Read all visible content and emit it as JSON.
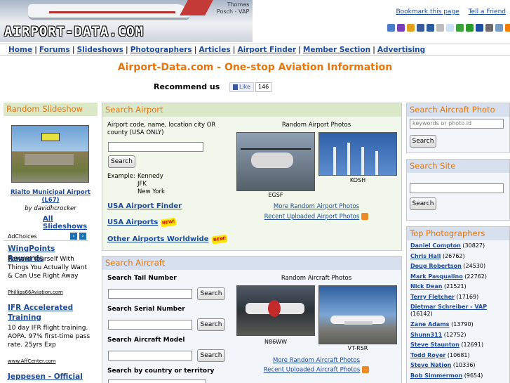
{
  "header": {
    "logo_text": "AIRPORT-DATA.COM",
    "photo_credit_line1": "Thomas",
    "photo_credit_line2": "Posch - VAP",
    "bookmark_label": "Bookmark this page",
    "tell_friend_label": "Tell a Friend",
    "social_icons": [
      {
        "name": "google-icon",
        "color": "#4a7ec8"
      },
      {
        "name": "yahoo-icon",
        "color": "#7b3fb5"
      },
      {
        "name": "windows-icon",
        "color": "#e1a21b"
      },
      {
        "name": "facebook-icon",
        "color": "#3b5998"
      },
      {
        "name": "digg-icon",
        "color": "#2a5d9f"
      },
      {
        "name": "delicious-icon",
        "color": "#bdbdbd"
      },
      {
        "name": "reddit-icon",
        "color": "#cde2f5"
      },
      {
        "name": "stumbleupon-icon",
        "color": "#3ca23c"
      },
      {
        "name": "technorati-icon",
        "color": "#2a9a2a"
      },
      {
        "name": "delicious-squares-icon",
        "color": "#1f4fa3"
      },
      {
        "name": "myspace-icon",
        "color": "#6b6b6b"
      },
      {
        "name": "share-icon",
        "color": "#7a9cc0"
      },
      {
        "name": "blogger-icon",
        "color": "#f57d00"
      }
    ]
  },
  "nav": {
    "items": [
      "Home",
      "Forums",
      "Slideshows",
      "Photographers",
      "Articles",
      "Airport Finder",
      "Member Section",
      "Advertising"
    ]
  },
  "headline": "Airport-Data.com - One-stop Aviation Information",
  "recommend": {
    "label": "Recommend us",
    "like_label": "Like",
    "like_count": "146"
  },
  "slideshow": {
    "title": "Random Slideshow",
    "caption_line1": "Rialto Municipal Airport",
    "caption_line2": "(L67)",
    "by": "by davidhcrocker",
    "all_link": "All Slideshows"
  },
  "ads": {
    "label": "AdChoices",
    "items": [
      {
        "title": "WingPoints Rewards",
        "body": "Reward Yourself With Things You Actually Want & Can Use Right Away",
        "url": "Phillips66Aviation.com"
      },
      {
        "title": "IFR Accelerated Training",
        "body": "10 day IFR flight training. AOPA. 97% first-time pass rate. 25yrs Exp",
        "url": "www.AffCenter.com"
      },
      {
        "title": "Jeppesen - Official Store",
        "body": "",
        "url": ""
      }
    ]
  },
  "search_airport": {
    "title": "Search Airport",
    "description": "Airport code, name, location city OR county (USA ONLY)",
    "input_value": "",
    "button": "Search",
    "example_label": "Example:",
    "examples": [
      "Kennedy",
      "JFK",
      "New York"
    ],
    "links": [
      "USA Airport Finder",
      "USA Airports",
      "Other Airports Worldwide"
    ],
    "new_badge": "NEW!",
    "random_title": "Random Airport Photos",
    "photos": [
      {
        "caption": "EGSF"
      },
      {
        "caption": "KOSH"
      }
    ],
    "more_link": "More Random Airport Photos",
    "recent_link": "Recent Uploaded Airport Photos"
  },
  "search_aircraft": {
    "title": "Search Aircraft",
    "tail_label": "Search Tail Number",
    "serial_label": "Search Serial Number",
    "model_label": "Search Aircraft Model",
    "country_label": "Search by country or territory",
    "button": "Search",
    "random_title": "Random Aircraft Photos",
    "photos": [
      {
        "caption": "N86WW"
      },
      {
        "caption": "VT-RSR"
      }
    ],
    "more_link": "More Random Aircraft Photos",
    "recent_link": "Recent Uploaded Aircraft Photos"
  },
  "search_photo": {
    "title": "Search Aircraft Photo",
    "placeholder": "keywords or photo id",
    "button": "Search"
  },
  "search_site": {
    "title": "Search Site",
    "button": "Search"
  },
  "top_photographers": {
    "title": "Top Photographers",
    "items": [
      {
        "name": "Daniel Compton",
        "count": "(30827)"
      },
      {
        "name": "Chris Hall",
        "count": "(26762)"
      },
      {
        "name": "Doug Robertson",
        "count": "(24530)"
      },
      {
        "name": "Mark Pasqualino",
        "count": "(22762)"
      },
      {
        "name": "Nick Dean",
        "count": "(21521)"
      },
      {
        "name": "Terry Fletcher",
        "count": "(17169)"
      },
      {
        "name": "Dietmar Schreiber - VAP",
        "count": "(16142)"
      },
      {
        "name": "Zane Adams",
        "count": "(13790)"
      },
      {
        "name": "Shunn311",
        "count": "(12752)"
      },
      {
        "name": "Steve Staunton",
        "count": "(12691)"
      },
      {
        "name": "Todd Royer",
        "count": "(10681)"
      },
      {
        "name": "Steve Nation",
        "count": "(10336)"
      },
      {
        "name": "Bob Simmermon",
        "count": "(9654)"
      }
    ]
  }
}
